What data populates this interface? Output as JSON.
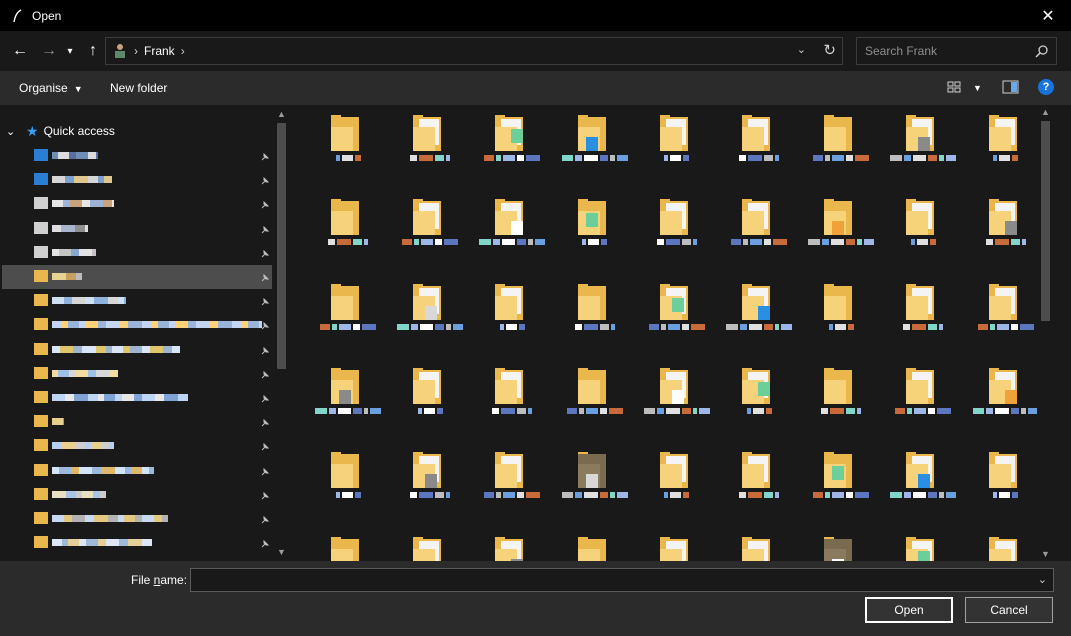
{
  "window": {
    "title": "Open",
    "close_glyph": "✕"
  },
  "nav": {
    "back_glyph": "←",
    "forward_glyph": "→",
    "recent_glyph": "⌄",
    "up_glyph": "↑",
    "breadcrumb": [
      "Frank"
    ],
    "search_placeholder": "Search Frank"
  },
  "commands": {
    "organise": "Organise",
    "new_folder": "New folder",
    "help": "?"
  },
  "sidebar": {
    "quick_access": "Quick access",
    "items": [
      {
        "icon": "desktop-icon",
        "color": "#2a7fd4",
        "sel": false
      },
      {
        "icon": "download-icon",
        "color": "#2a7fd4",
        "sel": false
      },
      {
        "icon": "documents-icon",
        "color": "#d0d0d0",
        "sel": false
      },
      {
        "icon": "music-icon",
        "color": "#d0d0d0",
        "sel": false
      },
      {
        "icon": "pictures-icon",
        "color": "#d0d0d0",
        "sel": false
      },
      {
        "icon": "folder-icon",
        "color": "#e9b74c",
        "sel": true
      },
      {
        "icon": "folder-icon",
        "color": "#e9b74c",
        "sel": false
      },
      {
        "icon": "folder-icon",
        "color": "#e9b74c",
        "sel": false
      },
      {
        "icon": "folder-icon",
        "color": "#e9b74c",
        "sel": false
      },
      {
        "icon": "folder-icon",
        "color": "#e9b74c",
        "sel": false
      },
      {
        "icon": "folder-icon",
        "color": "#e9b74c",
        "sel": false
      },
      {
        "icon": "folder-icon",
        "color": "#e9b74c",
        "sel": false
      },
      {
        "icon": "folder-icon",
        "color": "#e9b74c",
        "sel": false
      },
      {
        "icon": "folder-icon",
        "color": "#e9b74c",
        "sel": false
      },
      {
        "icon": "folder-icon",
        "color": "#e9b74c",
        "sel": false
      },
      {
        "icon": "folder-icon",
        "color": "#e9b74c",
        "sel": false
      },
      {
        "icon": "folder-icon",
        "color": "#e9b74c",
        "sel": false
      }
    ]
  },
  "bottom": {
    "file_name_label_pre": "File ",
    "file_name_label_u": "n",
    "file_name_label_post": "ame:",
    "file_name_value": "",
    "open": "Open",
    "cancel": "Cancel"
  },
  "colors": {
    "accent": "#1a73d9",
    "folder": "#e9b74c",
    "folder_front": "#f6d37a"
  }
}
